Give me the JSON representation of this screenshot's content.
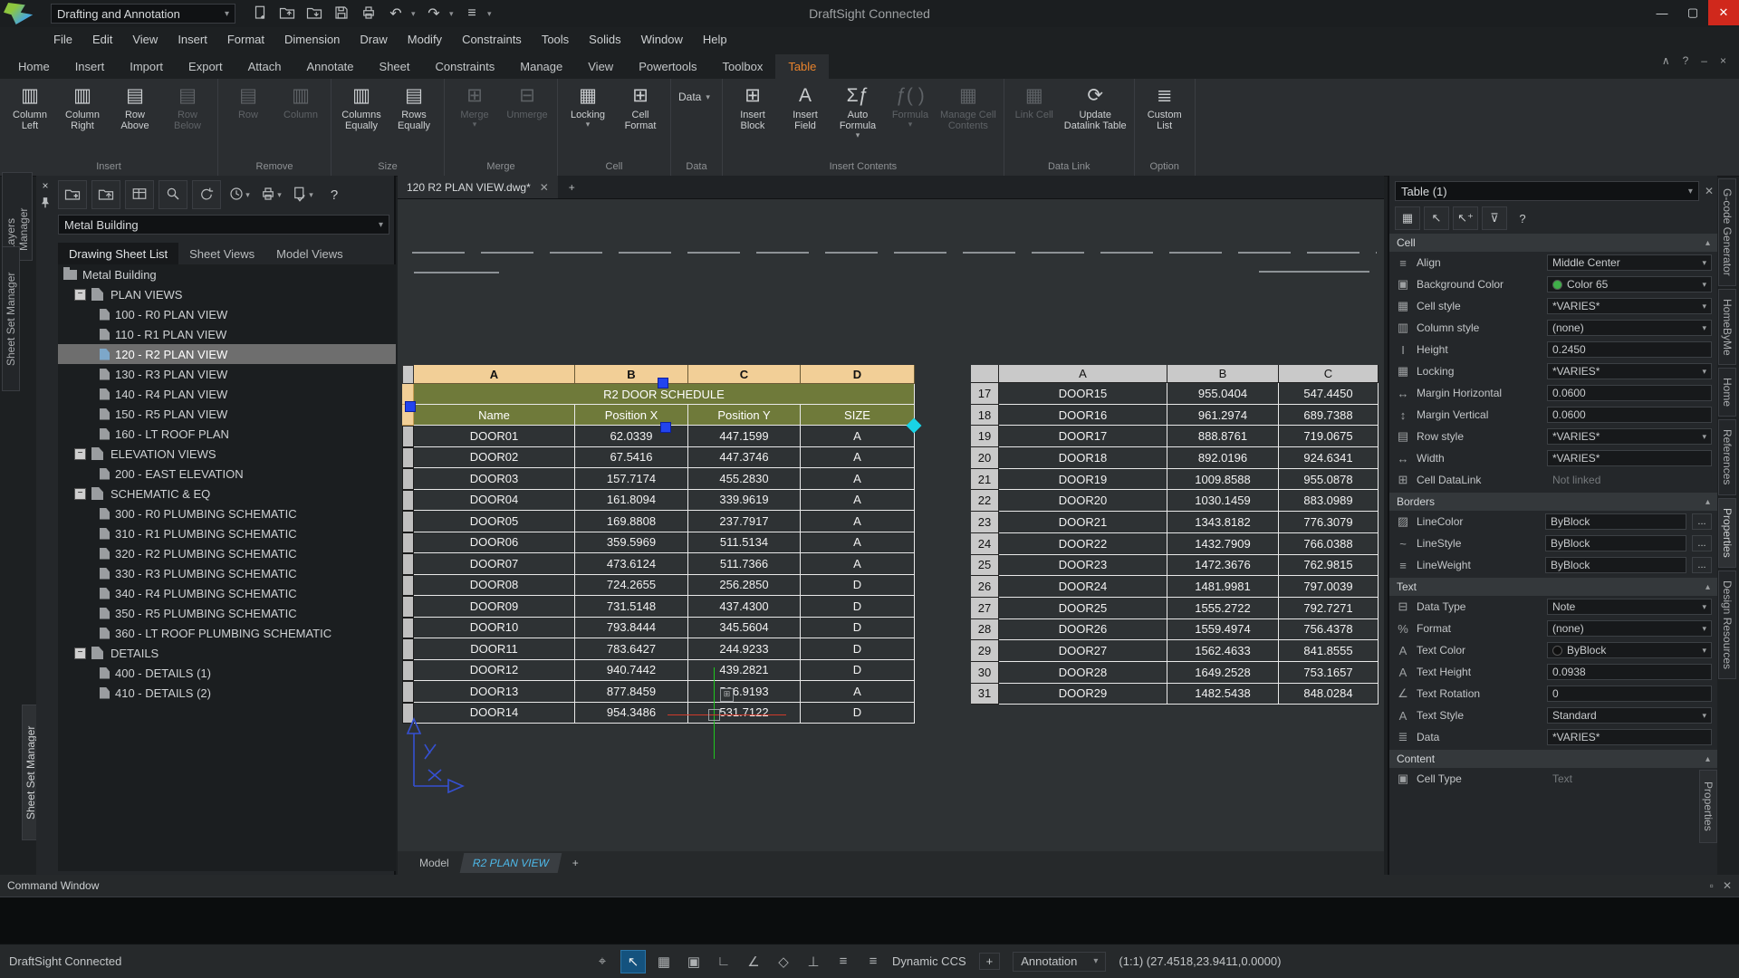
{
  "titlebar": {
    "workspace": "Drafting and Annotation",
    "title": "DraftSight Connected"
  },
  "menus": [
    "File",
    "Edit",
    "View",
    "Insert",
    "Format",
    "Dimension",
    "Draw",
    "Modify",
    "Constraints",
    "Tools",
    "Solids",
    "Window",
    "Help"
  ],
  "ribbon": {
    "tabs": [
      "Home",
      "Insert",
      "Import",
      "Export",
      "Attach",
      "Annotate",
      "Sheet",
      "Constraints",
      "Manage",
      "View",
      "Powertools",
      "Toolbox",
      "Table"
    ],
    "active_tab": "Table",
    "groups": [
      {
        "label": "Insert",
        "buttons": [
          {
            "label": "Column\nLeft",
            "icon": "column-left-icon",
            "enabled": true
          },
          {
            "label": "Column\nRight",
            "icon": "column-right-icon",
            "enabled": true
          },
          {
            "label": "Row\nAbove",
            "icon": "row-above-icon",
            "enabled": true
          },
          {
            "label": "Row\nBelow",
            "icon": "row-below-icon",
            "enabled": false
          }
        ]
      },
      {
        "label": "Remove",
        "buttons": [
          {
            "label": "Row",
            "icon": "remove-row-icon",
            "enabled": false
          },
          {
            "label": "Column",
            "icon": "remove-column-icon",
            "enabled": false
          }
        ]
      },
      {
        "label": "Size",
        "buttons": [
          {
            "label": "Columns\nEqually",
            "icon": "columns-equally-icon",
            "enabled": true
          },
          {
            "label": "Rows\nEqually",
            "icon": "rows-equally-icon",
            "enabled": true
          }
        ]
      },
      {
        "label": "Merge",
        "buttons": [
          {
            "label": "Merge",
            "icon": "merge-icon",
            "enabled": false,
            "dropdown": true
          },
          {
            "label": "Unmerge",
            "icon": "unmerge-icon",
            "enabled": false
          }
        ]
      },
      {
        "label": "Cell",
        "buttons": [
          {
            "label": "Locking",
            "icon": "locking-icon",
            "enabled": true,
            "dropdown": true
          },
          {
            "label": "Cell\nFormat",
            "icon": "cell-format-icon",
            "enabled": true
          }
        ]
      },
      {
        "label": "Data",
        "buttons": [
          {
            "label": "Data",
            "icon": "data-dropdown-icon",
            "enabled": true,
            "dropdown": true,
            "small": true
          }
        ]
      },
      {
        "label": "Insert Contents",
        "buttons": [
          {
            "label": "Insert\nBlock",
            "icon": "insert-block-icon",
            "enabled": true
          },
          {
            "label": "Insert\nField",
            "icon": "insert-field-icon",
            "enabled": true
          },
          {
            "label": "Auto\nFormula",
            "icon": "auto-formula-icon",
            "enabled": true,
            "dropdown": true
          },
          {
            "label": "Formula",
            "icon": "formula-icon",
            "enabled": false,
            "dropdown": true
          },
          {
            "label": "Manage Cell\nContents",
            "icon": "manage-cell-contents-icon",
            "enabled": false
          }
        ]
      },
      {
        "label": "Data Link",
        "buttons": [
          {
            "label": "Link Cell",
            "icon": "link-cell-icon",
            "enabled": false
          },
          {
            "label": "Update\nDatalink Table",
            "icon": "update-datalink-icon",
            "enabled": true
          }
        ]
      },
      {
        "label": "Option",
        "buttons": [
          {
            "label": "Custom\nList",
            "icon": "custom-list-icon",
            "enabled": true
          }
        ]
      }
    ]
  },
  "left_dock": {
    "tabs": [
      "Layers Manager",
      "Sheet Set Manager"
    ],
    "bottom_tab": "Sheet Set Manager"
  },
  "sheet_panel": {
    "combo": "Metal Building",
    "tabs": [
      "Drawing Sheet List",
      "Sheet Views",
      "Model Views"
    ],
    "active_tab": "Drawing Sheet List",
    "root": "Metal Building",
    "selected": "120 - R2 PLAN VIEW",
    "groups": [
      {
        "label": "PLAN VIEWS",
        "items": [
          "100 - R0 PLAN VIEW",
          "110 - R1 PLAN VIEW",
          "120 - R2 PLAN VIEW",
          "130 - R3 PLAN VIEW",
          "140 - R4 PLAN VIEW",
          "150 - R5 PLAN VIEW",
          "160 - LT ROOF PLAN"
        ]
      },
      {
        "label": "ELEVATION VIEWS",
        "items": [
          "200 - EAST ELEVATION"
        ]
      },
      {
        "label": "SCHEMATIC & EQ",
        "items": [
          "300 - R0 PLUMBING SCHEMATIC",
          "310 - R1 PLUMBING SCHEMATIC",
          "320 - R2 PLUMBING SCHEMATIC",
          "330 - R3 PLUMBING SCHEMATIC",
          "340 - R4 PLUMBING SCHEMATIC",
          "350 - R5 PLUMBING SCHEMATIC",
          "360 - LT ROOF PLUMBING SCHEMATIC"
        ]
      },
      {
        "label": "DETAILS",
        "items": [
          "400 - DETAILS (1)",
          "410 - DETAILS (2)"
        ]
      }
    ]
  },
  "document": {
    "tab": "120 R2 PLAN VIEW.dwg*",
    "sheet_tabs": [
      "Model",
      "R2 PLAN VIEW"
    ],
    "active_sheet": "R2 PLAN VIEW",
    "new_tab": "+"
  },
  "door_schedule": {
    "column_letters": [
      "A",
      "B",
      "C",
      "D"
    ],
    "title": "R2 DOOR SCHEDULE",
    "headers": [
      "Name",
      "Position X",
      "Position Y",
      "SIZE"
    ],
    "rows": [
      [
        "DOOR01",
        "62.0339",
        "447.1599",
        "A"
      ],
      [
        "DOOR02",
        "67.5416",
        "447.3746",
        "A"
      ],
      [
        "DOOR03",
        "157.7174",
        "455.2830",
        "A"
      ],
      [
        "DOOR04",
        "161.8094",
        "339.9619",
        "A"
      ],
      [
        "DOOR05",
        "169.8808",
        "237.7917",
        "A"
      ],
      [
        "DOOR06",
        "359.5969",
        "511.5134",
        "A"
      ],
      [
        "DOOR07",
        "473.6124",
        "511.7366",
        "A"
      ],
      [
        "DOOR08",
        "724.2655",
        "256.2850",
        "D"
      ],
      [
        "DOOR09",
        "731.5148",
        "437.4300",
        "D"
      ],
      [
        "DOOR10",
        "793.8444",
        "345.5604",
        "D"
      ],
      [
        "DOOR11",
        "783.6427",
        "244.9233",
        "D"
      ],
      [
        "DOOR12",
        "940.7442",
        "439.2821",
        "D"
      ],
      [
        "DOOR13",
        "877.8459",
        "506.9193",
        "A"
      ],
      [
        "DOOR14",
        "954.3486",
        "531.7122",
        "D"
      ]
    ]
  },
  "door_table2": {
    "column_letters": [
      "A",
      "B",
      "C"
    ],
    "rows": [
      [
        "17",
        "DOOR15",
        "955.0404",
        "547.4450"
      ],
      [
        "18",
        "DOOR16",
        "961.2974",
        "689.7388"
      ],
      [
        "19",
        "DOOR17",
        "888.8761",
        "719.0675"
      ],
      [
        "20",
        "DOOR18",
        "892.0196",
        "924.6341"
      ],
      [
        "21",
        "DOOR19",
        "1009.8588",
        "955.0878"
      ],
      [
        "22",
        "DOOR20",
        "1030.1459",
        "883.0989"
      ],
      [
        "23",
        "DOOR21",
        "1343.8182",
        "776.3079"
      ],
      [
        "24",
        "DOOR22",
        "1432.7909",
        "766.0388"
      ],
      [
        "25",
        "DOOR23",
        "1472.3676",
        "762.9815"
      ],
      [
        "26",
        "DOOR24",
        "1481.9981",
        "797.0039"
      ],
      [
        "27",
        "DOOR25",
        "1555.2722",
        "792.7271"
      ],
      [
        "28",
        "DOOR26",
        "1559.4974",
        "756.4378"
      ],
      [
        "29",
        "DOOR27",
        "1562.4633",
        "841.8555"
      ],
      [
        "30",
        "DOOR28",
        "1649.2528",
        "753.1657"
      ],
      [
        "31",
        "DOOR29",
        "1482.5438",
        "848.0284"
      ]
    ]
  },
  "properties": {
    "title": "Table (1)",
    "sections": [
      {
        "title": "Cell",
        "rows": [
          {
            "icon": "align-icon",
            "label": "Align",
            "value": "Middle Center",
            "type": "dropdown"
          },
          {
            "icon": "background-color-icon",
            "label": "Background Color",
            "value": "Color 65",
            "type": "dropdown",
            "swatch": "#3fae49"
          },
          {
            "icon": "cell-style-icon",
            "label": "Cell style",
            "value": "*VARIES*",
            "type": "dropdown"
          },
          {
            "icon": "column-style-icon",
            "label": "Column style",
            "value": "(none)",
            "type": "dropdown"
          },
          {
            "icon": "height-icon",
            "label": "Height",
            "value": "0.2450",
            "type": "field"
          },
          {
            "icon": "locking-icon",
            "label": "Locking",
            "value": "*VARIES*",
            "type": "dropdown"
          },
          {
            "icon": "margin-horizontal-icon",
            "label": "Margin Horizontal",
            "value": "0.0600",
            "type": "field"
          },
          {
            "icon": "margin-vertical-icon",
            "label": "Margin Vertical",
            "value": "0.0600",
            "type": "field"
          },
          {
            "icon": "row-style-icon",
            "label": "Row style",
            "value": "*VARIES*",
            "type": "dropdown"
          },
          {
            "icon": "width-icon",
            "label": "Width",
            "value": "*VARIES*",
            "type": "field"
          },
          {
            "icon": "cell-datalink-icon",
            "label": "Cell DataLink",
            "value": "Not linked",
            "type": "plain"
          }
        ]
      },
      {
        "title": "Borders",
        "rows": [
          {
            "icon": "linecolor-icon",
            "label": "LineColor",
            "value": "ByBlock",
            "type": "ellipsis"
          },
          {
            "icon": "linestyle-icon",
            "label": "LineStyle",
            "value": "ByBlock",
            "type": "ellipsis"
          },
          {
            "icon": "lineweight-icon",
            "label": "LineWeight",
            "value": "ByBlock",
            "type": "ellipsis"
          }
        ]
      },
      {
        "title": "Text",
        "rows": [
          {
            "icon": "data-type-icon",
            "label": "Data Type",
            "value": "Note",
            "type": "dropdown"
          },
          {
            "icon": "format-icon",
            "label": "Format",
            "value": "(none)",
            "type": "dropdown"
          },
          {
            "icon": "text-color-icon",
            "label": "Text Color",
            "value": "ByBlock",
            "type": "dropdown",
            "swatch": "#101010"
          },
          {
            "icon": "text-height-icon",
            "label": "Text Height",
            "value": "0.0938",
            "type": "field"
          },
          {
            "icon": "text-rotation-icon",
            "label": "Text Rotation",
            "value": "0",
            "type": "field"
          },
          {
            "icon": "text-style-icon",
            "label": "Text Style",
            "value": "Standard",
            "type": "dropdown"
          },
          {
            "icon": "data-icon",
            "label": "Data",
            "value": "*VARIES*",
            "type": "field"
          }
        ]
      },
      {
        "title": "Content",
        "rows": [
          {
            "icon": "cell-type-icon",
            "label": "Cell Type",
            "value": "Text",
            "type": "plain"
          }
        ]
      }
    ]
  },
  "right_dock": {
    "tabs": [
      "G-code Generator",
      "HomeByMe",
      "Home",
      "References",
      "Properties",
      "Design Resources"
    ],
    "active": "Properties",
    "side_tab": "Properties"
  },
  "command_window": {
    "title": "Command Window"
  },
  "statusbar": {
    "app_status": "DraftSight Connected",
    "icons": [
      "snap-settings-icon",
      "pointer-select-icon",
      "grid-icon",
      "snap-icon",
      "ortho-icon",
      "polar-icon",
      "esnap-icon",
      "etrack-icon",
      "quick-input-icon",
      "lineweight-icon"
    ],
    "active_icon": "pointer-select-icon",
    "dynamic_ccs": "Dynamic CCS",
    "plus": "+",
    "annotation": "Annotation",
    "coords": "(1:1)  (27.4518,23.9411,0.0000)"
  },
  "colors": {
    "accent_orange": "#e8832c",
    "grip_blue": "#2244ee",
    "grip_cyan": "#19d3e6",
    "table_tan": "#f2cf97",
    "table_olive": "#6f7a3a",
    "color65_green": "#3fae49",
    "crosshair_green": "#1ec71e",
    "crosshair_red": "#d03a2a",
    "ucs_blue": "#3550d2"
  }
}
